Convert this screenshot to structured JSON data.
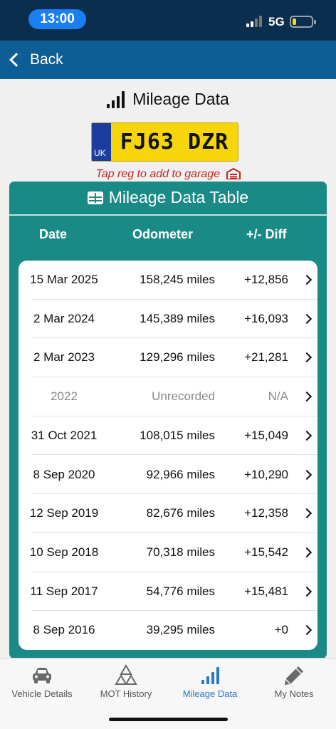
{
  "status": {
    "time": "13:00",
    "network": "5G"
  },
  "nav": {
    "back_label": "Back"
  },
  "header": {
    "title": "Mileage Data"
  },
  "plate": {
    "country": "UK",
    "registration": "FJ63 DZR"
  },
  "garage_hint": "Tap reg to add to garage",
  "table": {
    "title": "Mileage Data Table",
    "columns": [
      "Date",
      "Odometer",
      "+/- Diff"
    ],
    "rows": [
      {
        "date": "15 Mar 2025",
        "odometer": "158,245 miles",
        "diff": "+12,856",
        "muted": false
      },
      {
        "date": "2 Mar 2024",
        "odometer": "145,389 miles",
        "diff": "+16,093",
        "muted": false
      },
      {
        "date": "2 Mar 2023",
        "odometer": "129,296 miles",
        "diff": "+21,281",
        "muted": false
      },
      {
        "date": "2022",
        "odometer": "Unrecorded",
        "diff": "N/A",
        "muted": true
      },
      {
        "date": "31 Oct 2021",
        "odometer": "108,015 miles",
        "diff": "+15,049",
        "muted": false
      },
      {
        "date": "8 Sep 2020",
        "odometer": "92,966 miles",
        "diff": "+10,290",
        "muted": false
      },
      {
        "date": "12 Sep 2019",
        "odometer": "82,676 miles",
        "diff": "+12,358",
        "muted": false
      },
      {
        "date": "10 Sep 2018",
        "odometer": "70,318 miles",
        "diff": "+15,542",
        "muted": false
      },
      {
        "date": "11 Sep 2017",
        "odometer": "54,776 miles",
        "diff": "+15,481",
        "muted": false
      },
      {
        "date": "8 Sep 2016",
        "odometer": "39,295 miles",
        "diff": "+0",
        "muted": false
      }
    ]
  },
  "tabs": [
    {
      "label": "Vehicle Details",
      "icon": "car-icon",
      "active": false
    },
    {
      "label": "MOT History",
      "icon": "mot-triangles-icon",
      "active": false
    },
    {
      "label": "Mileage Data",
      "icon": "signal-bars-icon",
      "active": true
    },
    {
      "label": "My Notes",
      "icon": "pencil-icon",
      "active": false
    }
  ],
  "colors": {
    "status_bar": "#0c2e4e",
    "nav_bar": "#0e5e96",
    "card": "#1a8a86",
    "plate_yellow": "#f6d50a",
    "plate_blue": "#1d3c9f",
    "hint_red": "#c0281e",
    "tab_active": "#2a78c8"
  }
}
